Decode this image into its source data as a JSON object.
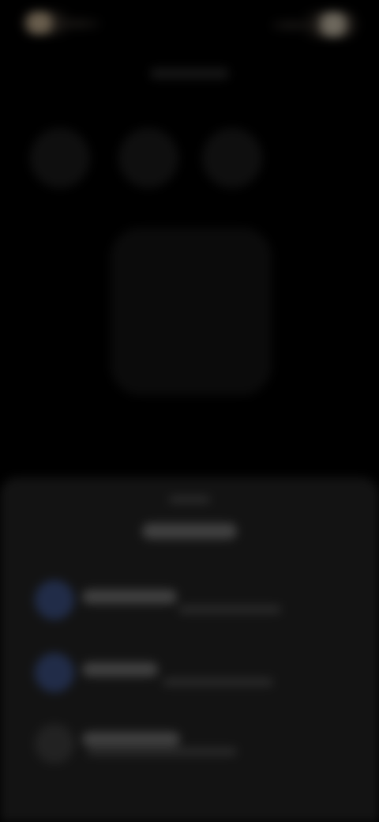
{
  "screen": {
    "state": "blurred-unreadable"
  },
  "colors": {
    "background": "#000000",
    "sheet": "#131313",
    "accent": "#283760"
  },
  "icons": {
    "status_left": "status-indicator-icon",
    "status_right": "status-indicator-icon",
    "row_1": "option-icon",
    "row_2": "option-icon",
    "row_3": "option-icon"
  }
}
